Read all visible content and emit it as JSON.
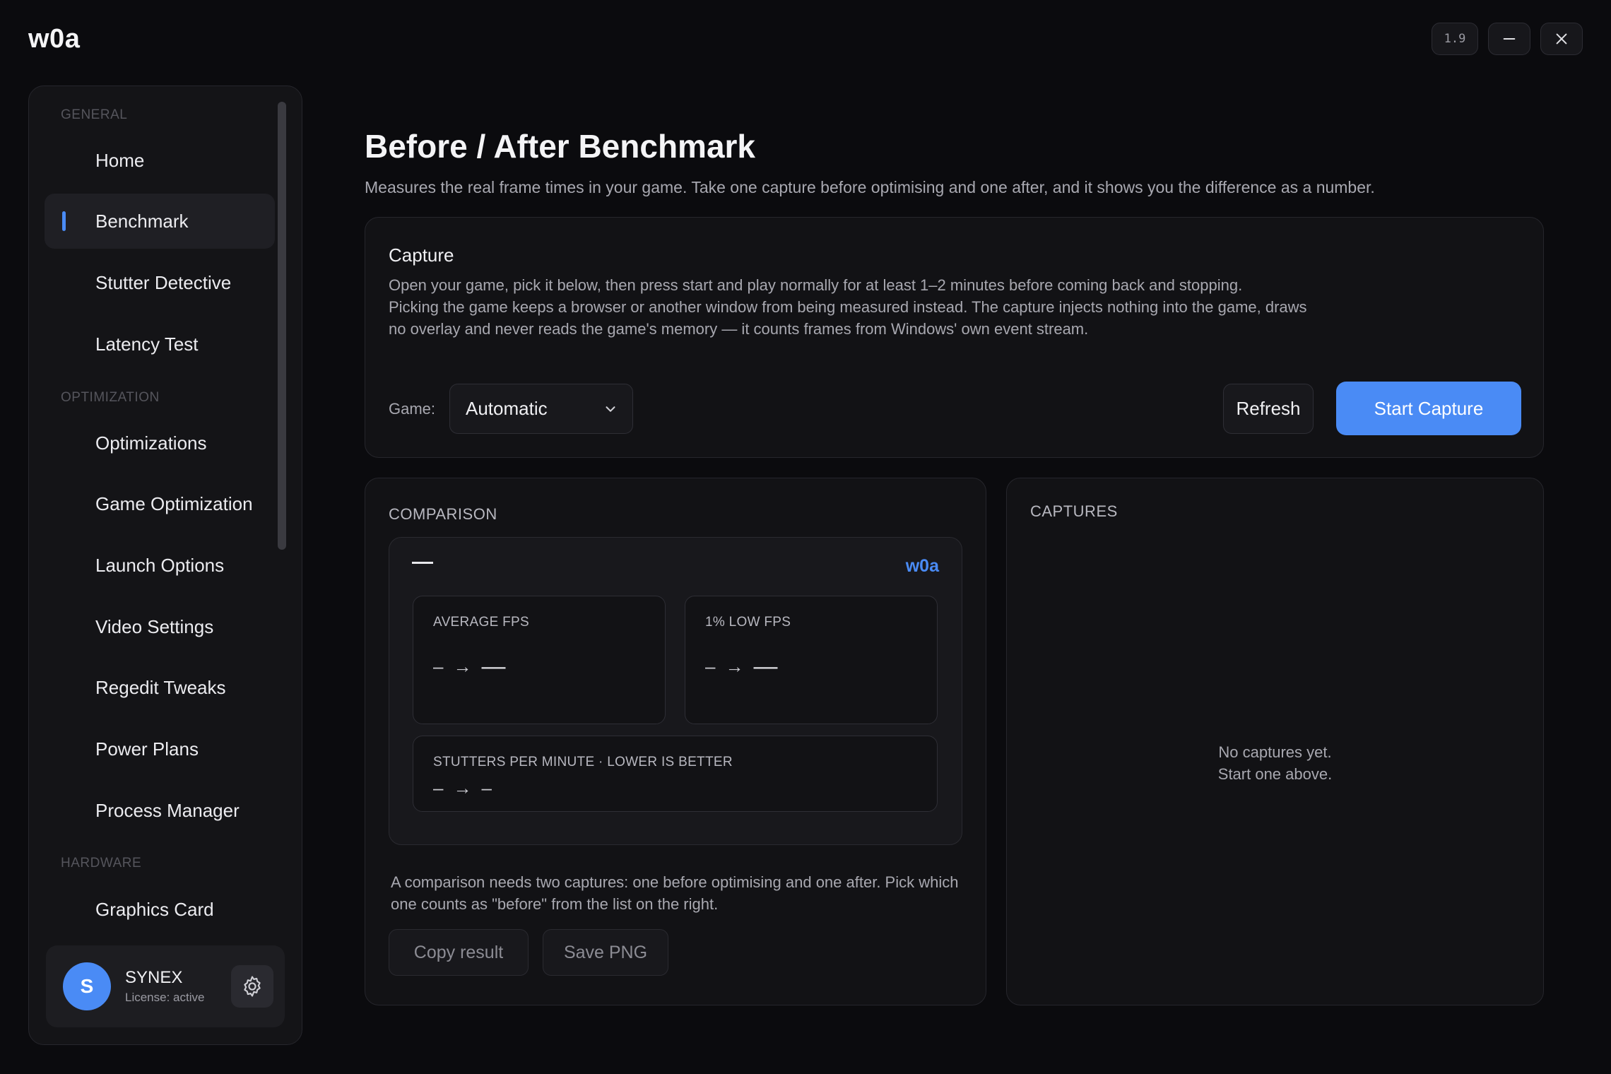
{
  "app": {
    "brand": "w0a",
    "version": "1.9"
  },
  "sidebar": {
    "sections": {
      "general": "GENERAL",
      "optimization": "OPTIMIZATION",
      "hardware": "HARDWARE"
    },
    "items": [
      {
        "label": "Home"
      },
      {
        "label": "Benchmark",
        "active": true
      },
      {
        "label": "Stutter Detective"
      },
      {
        "label": "Latency Test"
      },
      {
        "label": "Optimizations"
      },
      {
        "label": "Game Optimization"
      },
      {
        "label": "Launch Options"
      },
      {
        "label": "Video Settings"
      },
      {
        "label": "Regedit Tweaks"
      },
      {
        "label": "Power Plans"
      },
      {
        "label": "Process Manager"
      },
      {
        "label": "Graphics Card"
      }
    ],
    "user": {
      "initial": "S",
      "name": "SYNEX",
      "license": "License: active"
    }
  },
  "page": {
    "title": "Before / After Benchmark",
    "description": "Measures the real frame times in your game. Take one capture before optimising and one after, and it shows you the difference as a number."
  },
  "capture": {
    "title": "Capture",
    "line1": "Open your game, pick it below, then press start and play normally for at least 1–2 minutes before coming back and stopping.",
    "line2": "Picking the game keeps a browser or another window from being measured instead. The capture injects nothing into the game, draws no overlay and never reads the game's memory — it counts frames from Windows' own event stream.",
    "game_label": "Game:",
    "game_value": "Automatic",
    "refresh": "Refresh",
    "start": "Start Capture"
  },
  "comparison": {
    "label": "COMPARISON",
    "brand": "w0a",
    "metrics": {
      "avg": {
        "label": "AVERAGE FPS",
        "before": "–",
        "arrow": "→",
        "after": "—"
      },
      "low": {
        "label": "1% LOW FPS",
        "before": "–",
        "arrow": "→",
        "after": "—"
      },
      "stutter": {
        "label": "STUTTERS PER MINUTE · LOWER IS BETTER",
        "before": "–",
        "arrow": "→",
        "after": "–"
      }
    },
    "note": "A comparison needs two captures: one before optimising and one after. Pick which one counts as \"before\" from the list on the right.",
    "copy": "Copy result",
    "save": "Save PNG"
  },
  "captures": {
    "label": "CAPTURES",
    "empty_line1": "No captures yet.",
    "empty_line2": "Start one above."
  },
  "colors": {
    "accent": "#4a8bf5",
    "background": "#0b0b0e",
    "panel": "#141417"
  },
  "icons": {
    "minimize": "minimize-icon",
    "close": "close-icon",
    "settings": "gear-icon",
    "dropdown": "chevron-down-icon"
  }
}
